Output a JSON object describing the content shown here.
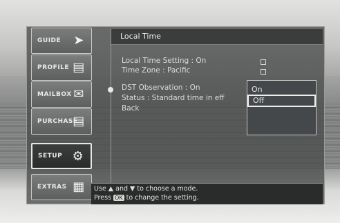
{
  "sidebar": {
    "items": [
      {
        "label": "GUIDE",
        "icon": "arrow-right-icon",
        "active": false
      },
      {
        "label": "PROFILE",
        "icon": "profile-card-icon",
        "active": false
      },
      {
        "label": "MAILBOX",
        "icon": "mailbox-icon",
        "active": false
      },
      {
        "label": "PURCHASE",
        "icon": "purchase-icon",
        "active": false
      },
      {
        "label": "SETUP",
        "icon": "setup-tools-icon",
        "active": true
      },
      {
        "label": "EXTRAS",
        "icon": "extras-grid-icon",
        "active": false
      }
    ]
  },
  "header": {
    "title": "Local Time"
  },
  "menu": [
    {
      "text": "Local Time Setting : On",
      "checkbox": true
    },
    {
      "text": "Time Zone : Pacific",
      "checkbox": true
    },
    {
      "text": "DST Observation : On",
      "checkbox": false,
      "selected": true
    },
    {
      "text": "Status : Standard time in eff",
      "checkbox": false
    },
    {
      "text": "Back",
      "checkbox": false
    }
  ],
  "popup": {
    "options": [
      {
        "label": "On",
        "highlighted": false
      },
      {
        "label": "Off",
        "highlighted": true
      }
    ]
  },
  "footer": {
    "line1_pre": "Use",
    "line1_mid": "and",
    "line1_post": "to choose a mode.",
    "line2_pre": "Press",
    "ok_label": "OK",
    "line2_post": "to change the setting."
  }
}
